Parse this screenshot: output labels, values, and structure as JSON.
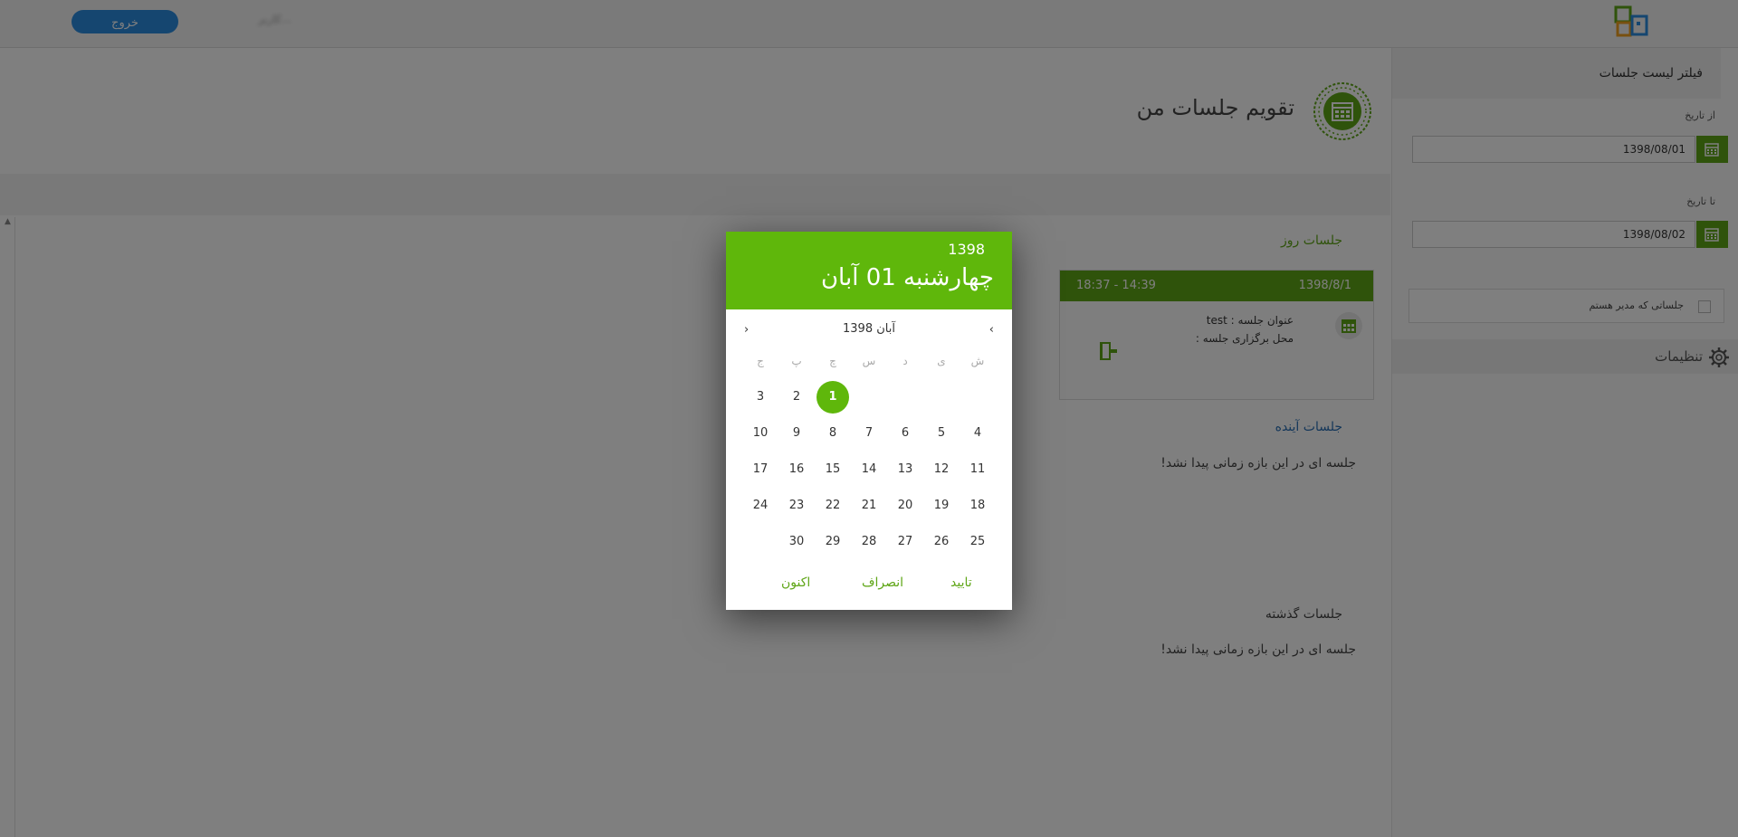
{
  "header": {
    "logout_label": "خروج",
    "user_text": "...کاربر"
  },
  "sidebar": {
    "title": "فیلتر لیست جلسات",
    "from_label": "از تاریخ",
    "from_value": "1398/08/01",
    "to_label": "تا تاریخ",
    "to_value": "1398/08/02",
    "manager_filter_label": "جلساتی که مدیر هستم",
    "settings_label": "تنظیمات"
  },
  "main": {
    "page_title": "تقویم جلسات من",
    "today_heading": "جلسات روز",
    "meeting": {
      "date": "1398/8/1",
      "time": "18:37 - 14:39",
      "title_line": "عنوان جلسه : test",
      "location_line": "محل برگزاری جلسه :"
    },
    "upcoming_heading": "جلسات آینده",
    "upcoming_empty": "جلسه ای در این بازه زمانی پیدا نشد!",
    "past_heading": "جلسات گذشته",
    "past_empty": "جلسه ای در این بازه زمانی پیدا نشد!"
  },
  "datepicker": {
    "year": "1398",
    "selected_date": "چهارشنبه 01 آبان",
    "month_label": "آبان 1398",
    "weekdays": [
      "ش",
      "ی",
      "د",
      "س",
      "چ",
      "پ",
      "ج"
    ],
    "weeks": [
      [
        "",
        "",
        "",
        "",
        "1",
        "2",
        "3"
      ],
      [
        "4",
        "5",
        "6",
        "7",
        "8",
        "9",
        "10"
      ],
      [
        "11",
        "12",
        "13",
        "14",
        "15",
        "16",
        "17"
      ],
      [
        "18",
        "19",
        "20",
        "21",
        "22",
        "23",
        "24"
      ],
      [
        "25",
        "26",
        "27",
        "28",
        "29",
        "30",
        ""
      ]
    ],
    "selected_day": "1",
    "confirm_label": "تایید",
    "cancel_label": "انصراف",
    "now_label": "اکنون"
  },
  "colors": {
    "accent_green": "#5fb70b",
    "logout_blue": "#2a8ce0"
  }
}
